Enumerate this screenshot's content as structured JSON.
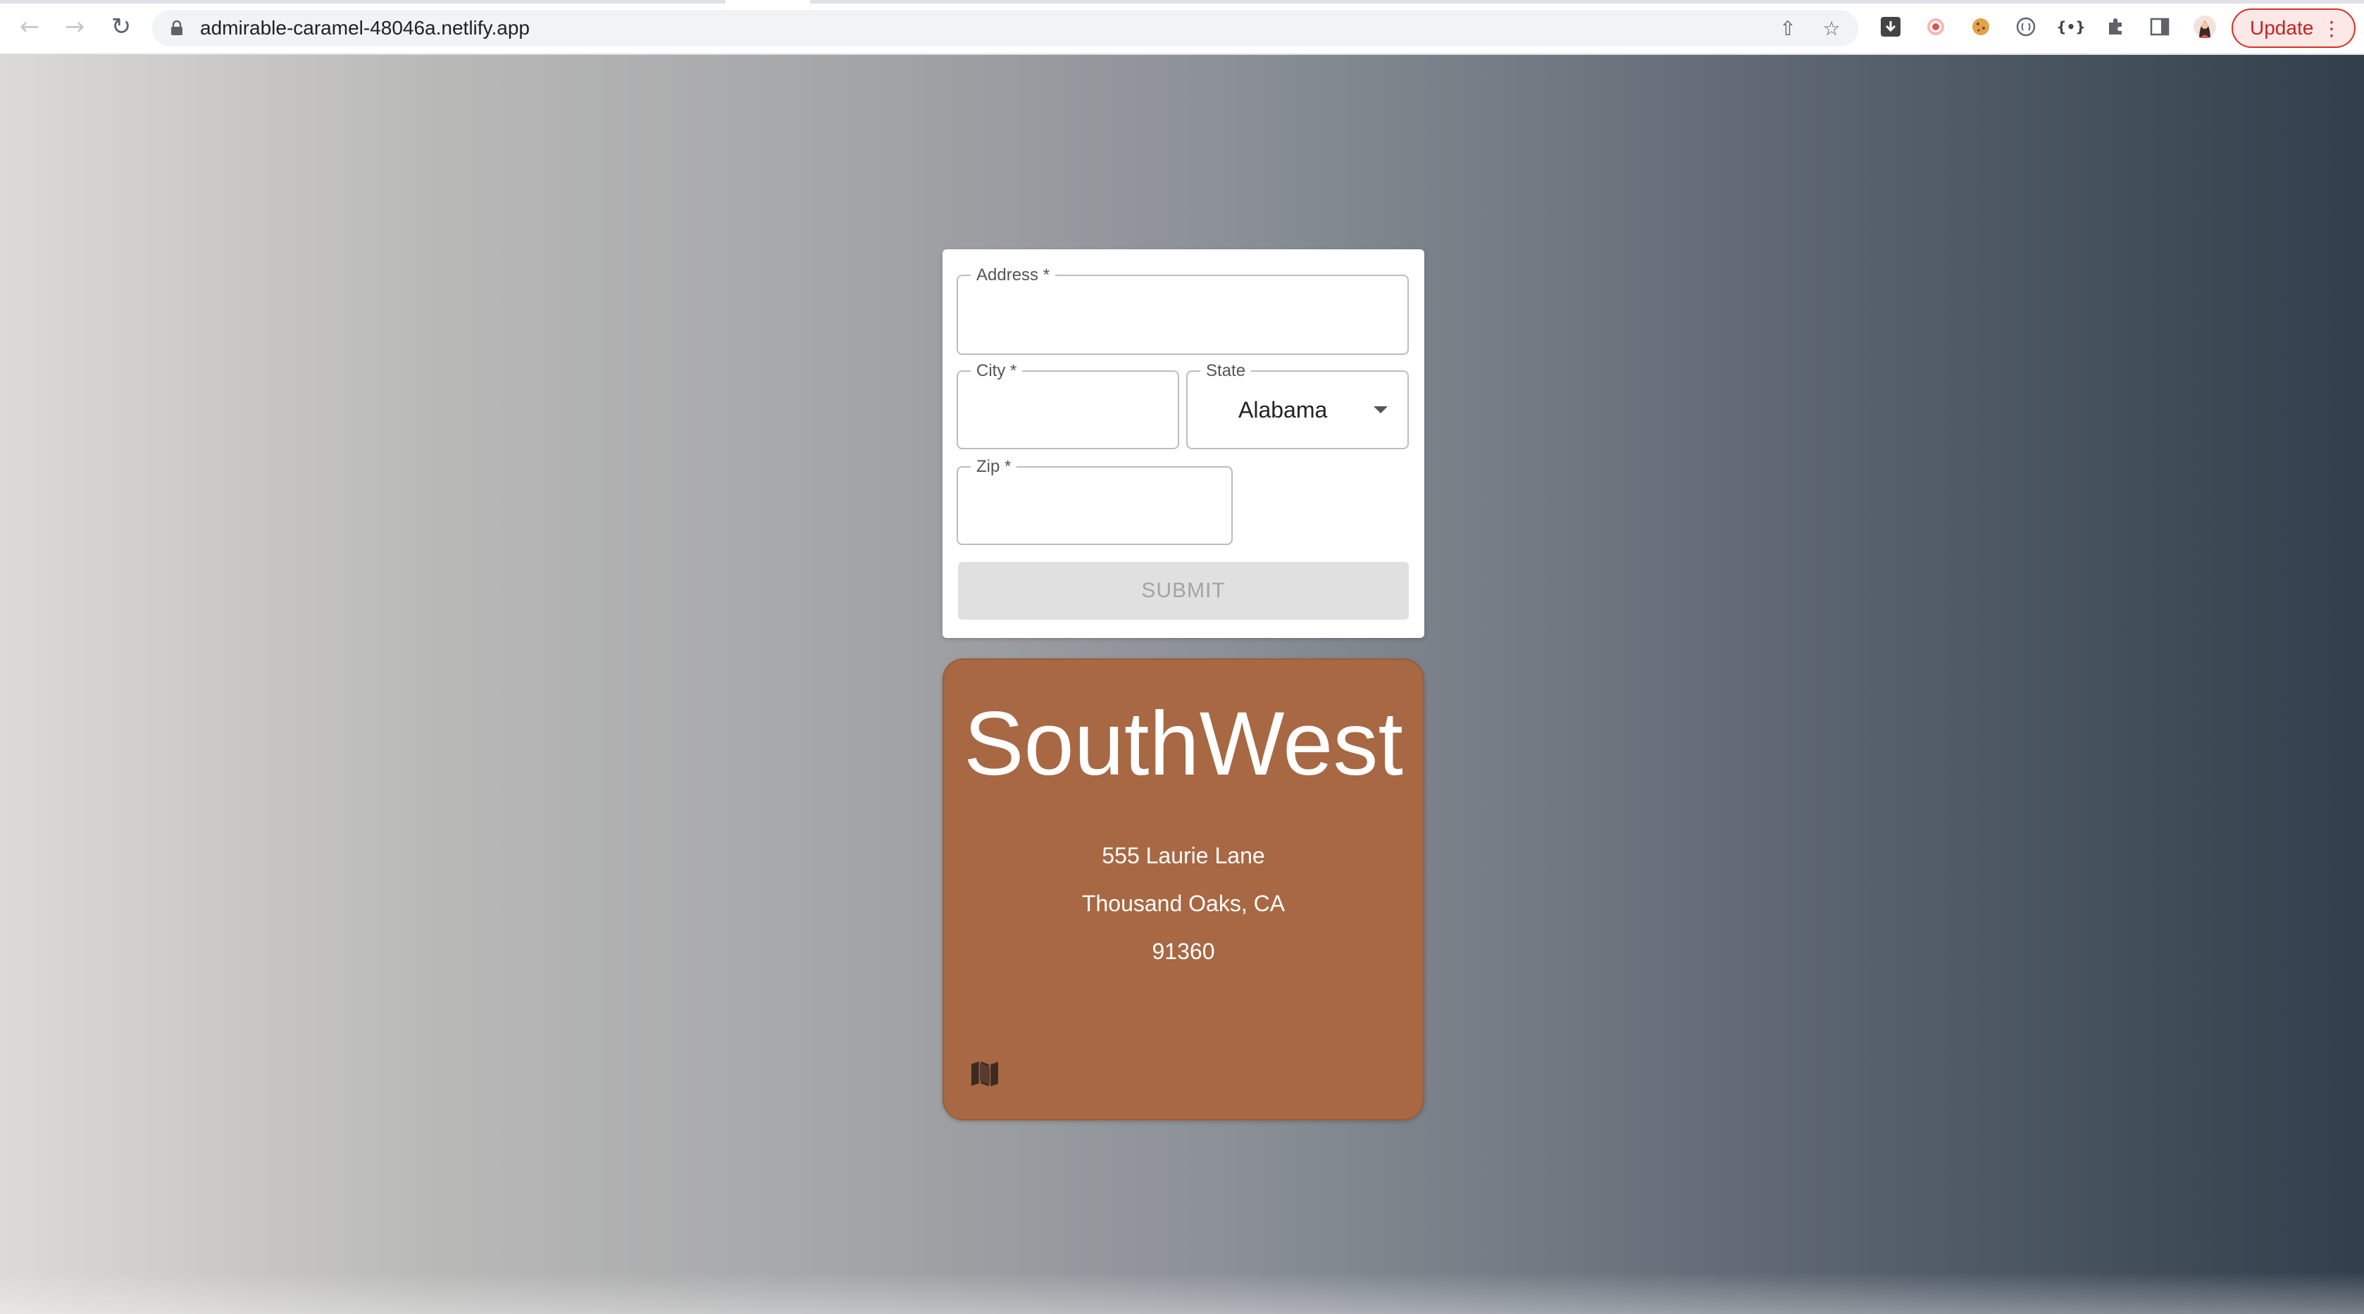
{
  "browser": {
    "url": "admirable-caramel-48046a.netlify.app",
    "update_label": "Update",
    "nav": {
      "back_icon": "arrow-left-icon",
      "forward_icon": "arrow-right-icon",
      "reload_icon": "reload-icon"
    }
  },
  "form": {
    "address": {
      "label": "Address *",
      "value": ""
    },
    "city": {
      "label": "City *",
      "value": ""
    },
    "state": {
      "label": "State",
      "selected": "Alabama"
    },
    "zip": {
      "label": "Zip *",
      "value": ""
    },
    "submit_label": "SUBMIT"
  },
  "card": {
    "name": "SouthWest",
    "street": "555 Laurie Lane",
    "city_state": "Thousand Oaks, CA",
    "zip": "91360",
    "icon": "map-icon"
  },
  "colors": {
    "card_bg": "#a76843",
    "update_border": "#d93025"
  }
}
